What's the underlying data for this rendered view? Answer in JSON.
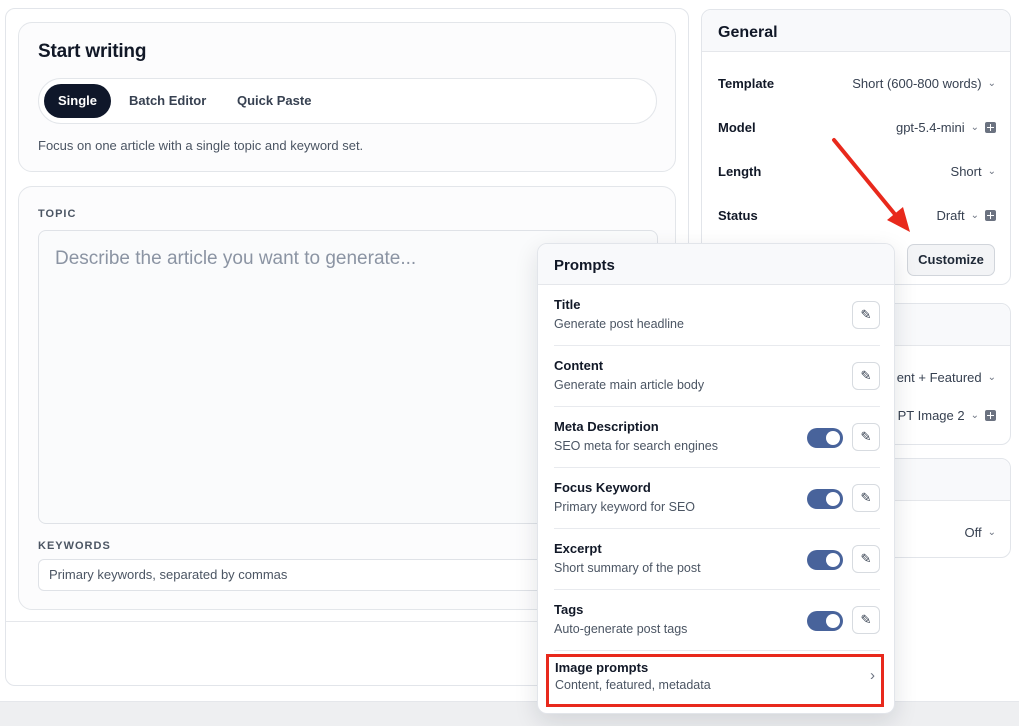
{
  "start": {
    "title": "Start writing",
    "tabs": [
      "Single",
      "Batch Editor",
      "Quick Paste"
    ],
    "description": "Focus on one article with a single topic and keyword set."
  },
  "topic": {
    "label": "TOPIC",
    "placeholder": "Describe the article you want to generate..."
  },
  "keywords": {
    "label": "KEYWORDS",
    "placeholder": "Primary keywords, separated by commas"
  },
  "general": {
    "title": "General",
    "rows": [
      {
        "label": "Template",
        "value": "Short (600-800 words)",
        "icon": "chevron-down-icon"
      },
      {
        "label": "Model",
        "value": "gpt-5.4-mini",
        "icon": "plus-square-icon"
      },
      {
        "label": "Length",
        "value": "Short",
        "icon": "chevron-down-icon"
      },
      {
        "label": "Status",
        "value": "Draft",
        "icon": "plus-square-icon"
      }
    ],
    "customize_label": "Customize"
  },
  "images": {
    "visible_values": [
      "ent + Featured",
      "PT Image 2"
    ]
  },
  "third": {
    "visible_value": "Off"
  },
  "prompts": {
    "title": "Prompts",
    "items": [
      {
        "name": "Title",
        "desc": "Generate post headline",
        "toggle": false
      },
      {
        "name": "Content",
        "desc": "Generate main article body",
        "toggle": false
      },
      {
        "name": "Meta Description",
        "desc": "SEO meta for search engines",
        "toggle": true
      },
      {
        "name": "Focus Keyword",
        "desc": "Primary keyword for SEO",
        "toggle": true
      },
      {
        "name": "Excerpt",
        "desc": "Short summary of the post",
        "toggle": true
      },
      {
        "name": "Tags",
        "desc": "Auto-generate post tags",
        "toggle": true
      }
    ],
    "image_prompts": {
      "name": "Image prompts",
      "desc": "Content, featured, metadata"
    }
  },
  "colors": {
    "accent": "#0f172a",
    "toggle_on": "#48639b",
    "highlight": "#e8291c"
  }
}
